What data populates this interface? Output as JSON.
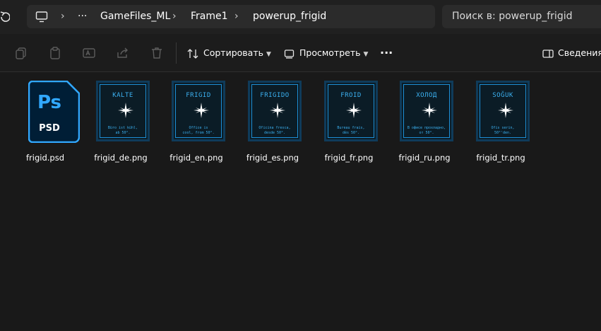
{
  "address": {
    "crumbs": [
      "GameFiles_ML",
      "Frame1",
      "powerup_frigid"
    ],
    "more": "···"
  },
  "search": {
    "placeholder": "Поиск в: powerup_frigid"
  },
  "toolbar": {
    "sort_label": "Сортировать",
    "view_label": "Просмотреть",
    "more_label": "···",
    "details_label": "Сведения"
  },
  "psd": {
    "label": "frigid.psd",
    "ps": "Ps",
    "ext": "PSD"
  },
  "files": [
    {
      "label": "frigid_de.png",
      "title": "KALTE",
      "text": "Büro ist kühl,\nab 50°."
    },
    {
      "label": "frigid_en.png",
      "title": "FRIGID",
      "text": "Office is\ncool, from 50°."
    },
    {
      "label": "frigid_es.png",
      "title": "FRIGIDO",
      "text": "Oficina fresca,\ndesde 50°."
    },
    {
      "label": "frigid_fr.png",
      "title": "FROID",
      "text": "Bureau frais,\ndès 50°."
    },
    {
      "label": "frigid_ru.png",
      "title": "ХОЛОД",
      "text": "В офисе прохладно,\nот 50°."
    },
    {
      "label": "frigid_tr.png",
      "title": "SOĞUK",
      "text": "Ofis serin,\n50°'den."
    }
  ],
  "colors": {
    "accent": "#1d8fd6",
    "psd_blue": "#31a8ff",
    "psd_bg": "#001e36"
  }
}
